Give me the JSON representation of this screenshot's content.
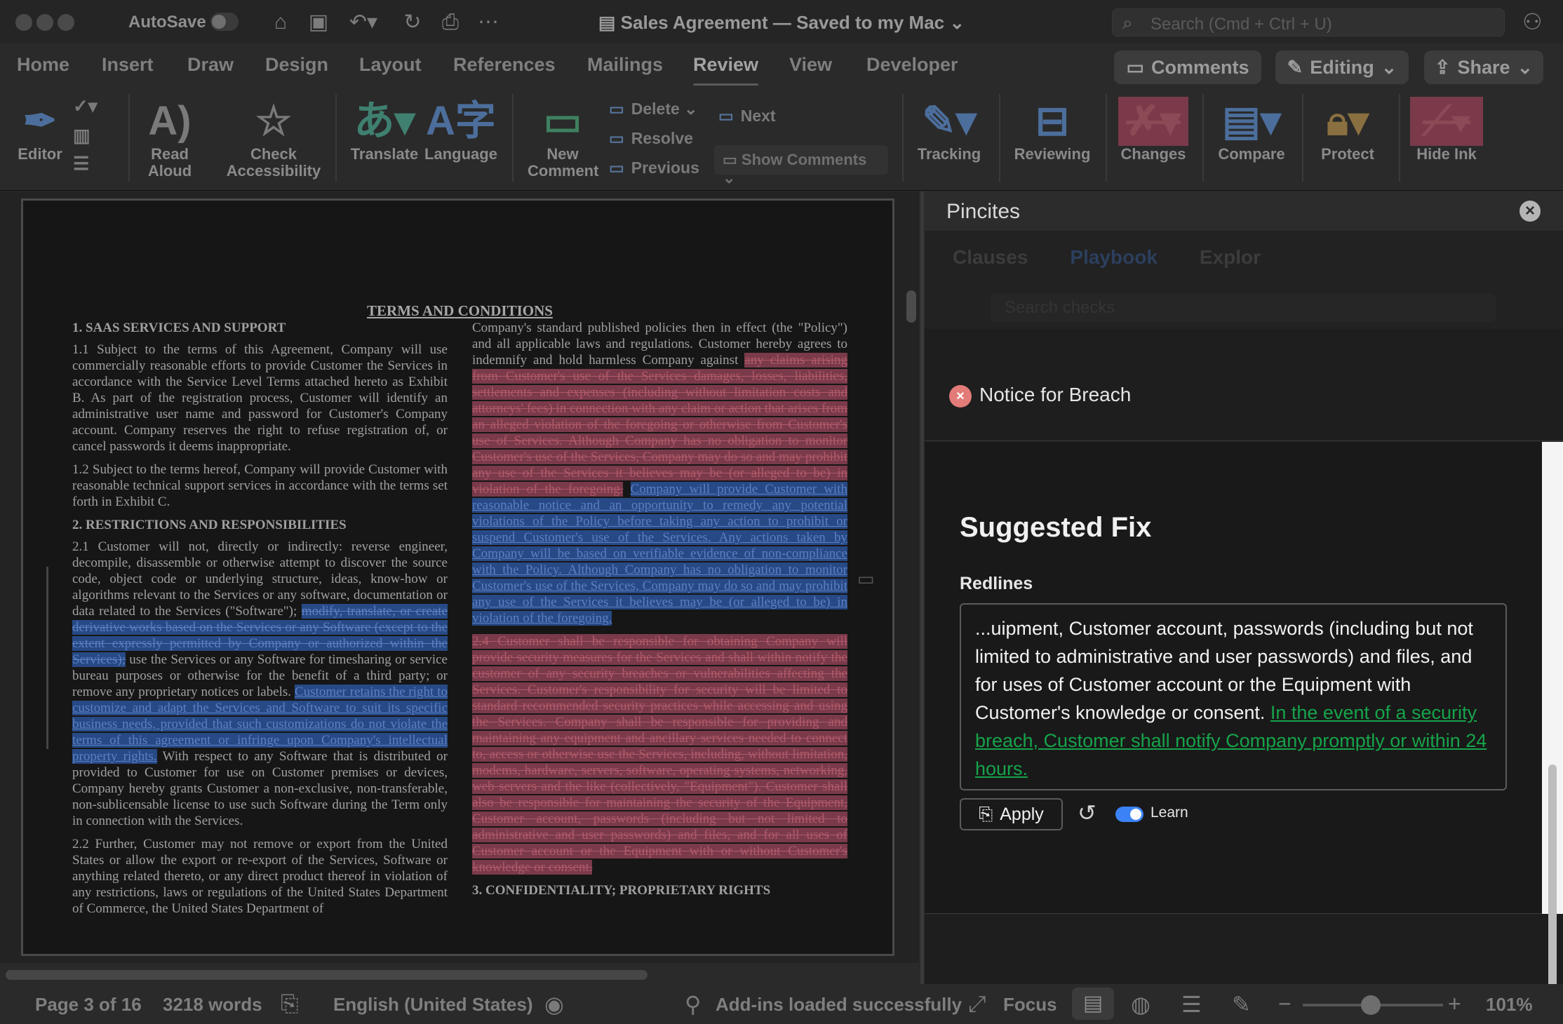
{
  "titlebar": {
    "autosave_label": "AutoSave",
    "doc_title": "Sales Agreement — Saved to my Mac",
    "search_placeholder": "Search (Cmd + Ctrl + U)"
  },
  "tabs": [
    "Home",
    "Insert",
    "Draw",
    "Design",
    "Layout",
    "References",
    "Mailings",
    "Review",
    "View",
    "Developer"
  ],
  "active_tab": "Review",
  "header_buttons": {
    "comments": "Comments",
    "editing": "Editing",
    "share": "Share"
  },
  "ribbon": {
    "editor": "Editor",
    "read_aloud": [
      "Read",
      "Aloud"
    ],
    "check_accessibility": [
      "Check",
      "Accessibility"
    ],
    "translate": "Translate",
    "language": "Language",
    "new_comment": [
      "New",
      "Comment"
    ],
    "delete": "Delete",
    "resolve": "Resolve",
    "previous": "Previous",
    "next": "Next",
    "show_comments": "Show Comments",
    "tracking": "Tracking",
    "reviewing": "Reviewing",
    "changes": "Changes",
    "compare": "Compare",
    "protect": "Protect",
    "hide_ink": "Hide Ink"
  },
  "document": {
    "title": "TERMS AND CONDITIONS",
    "section1_heading": "1.        SAAS SERVICES AND SUPPORT",
    "p11": "1.1       Subject to the terms of this Agreement, Company will use commercially reasonable efforts to provide Customer the Services in accordance with the Service Level Terms attached hereto as Exhibit B. As part of the registration process, Customer will identify an administrative user name and password for Customer's Company account. Company reserves the right to refuse registration of, or cancel passwords it deems inappropriate.",
    "p12": "1.2       Subject to the terms hereof, Company will provide Customer with reasonable technical support services in accordance with the terms set forth in Exhibit C.",
    "section2_heading": "2.        RESTRICTIONS AND RESPONSIBILITIES",
    "p21a": "2.1       Customer will not, directly or indirectly: reverse engineer, decompile, disassemble or otherwise attempt to discover the source code, object code or underlying structure, ideas, know-how or algorithms relevant to the Services or any software, documentation or data related to the Services (\"Software\");",
    "p21_del": "modify, translate, or create derivative works based on the Services or any Software (except to the extent expressly permitted by Company or authorized within the Services);",
    "p21b": "use the Services or any Software for timesharing or service bureau purposes or otherwise for the benefit of a third party; or remove any proprietary notices or labels.",
    "p21_ins": "Customer retains the right to customize and adapt the Services and Software to suit its specific business needs, provided that such customizations do not violate the terms of this agreement or infringe upon Company's intellectual property rights.",
    "p21c": "With respect to any Software that is distributed or provided to Customer for use on Customer premises or devices, Company hereby grants Customer a non-exclusive, non-transferable, non-sublicensable license to use such Software during the Term only in connection with the Services.",
    "p22": "2.2       Further, Customer may not remove or export from the United States or allow the export or re-export of the Services, Software or anything related thereto, or any direct product thereof in violation of any restrictions, laws or regulations of the United States Department of Commerce, the United States Department of",
    "r1": "Company's standard published policies then in effect (the \"Policy\") and all applicable laws and regulations. Customer hereby agrees to indemnify and hold harmless Company against",
    "r_del": "any claims arising from Customer's use of the Services damages, losses, liabilities, settlements and expenses (including without limitation costs and attorneys' fees) in connection with any claim or action that arises from an alleged violation of the foregoing or otherwise from Customer's use of Services. Although Company has no obligation to monitor Customer's use of the Services, Company may do so and may prohibit any use of the Services it believes may be (or alleged to be) in violation of the foregoing.",
    "r_ins": "Company will provide Customer with reasonable notice and an opportunity to remedy any potential violations of the Policy before taking any action to prohibit or suspend Customer's use of the Services. Any actions taken by Company will be based on verifiable evidence of non-compliance with the Policy. Although Company has no obligation to monitor Customer's use of the Services, Company may do so and may prohibit any use of the Services it believes may be (or alleged to be) in violation of the foregoing.",
    "r24": "2.4       Customer shall be responsible for obtaining Company will provide security measures for the Services and shall within notify the customer of any security breaches or vulnerabilities affecting the Services. Customer's responsibility for security will be limited to standard recommended security practices while accessing and using the Services. Company shall be responsible for providing and maintaining any equipment and ancillary services needed to connect to, access or otherwise use the Services, including, without limitation, modems, hardware, servers, software, operating systems, networking, web servers and the like (collectively, \"Equipment\"). Customer shall also be responsible for maintaining the security of the Equipment, Customer account, passwords (including but not limited to administrative and user passwords) and files, and for all uses of Customer account or the Equipment with or without Customer's knowledge or consent.",
    "section3_heading": "3.        CONFIDENTIALITY; PROPRIETARY RIGHTS"
  },
  "pane": {
    "title": "Pincites",
    "blur_tabs": [
      "Clauses",
      "Playbook",
      "Explor"
    ],
    "blur_search": "Search checks",
    "notice": "Notice for Breach",
    "suggested_fix": "Suggested Fix",
    "redlines_label": "Redlines",
    "redline_text": "...uipment, Customer account, passwords (including but not limited to administrative and user passwords) and files, and for uses of Customer account or the Equipment with Customer's knowledge or consent.",
    "redline_insert": "In the event of a security breach, Customer shall notify Company promptly or within 24 hours.",
    "apply": "Apply",
    "learn": "Learn",
    "learn_on": true
  },
  "statusbar": {
    "page": "Page 3 of 16",
    "words": "3218 words",
    "language": "English (United States)",
    "addins": "Add-ins loaded successfully",
    "focus": "Focus",
    "zoom": "101%"
  },
  "colors": {
    "accent": "#3b82f6",
    "insert_green": "#16a34a",
    "error_red": "#e37b78"
  }
}
